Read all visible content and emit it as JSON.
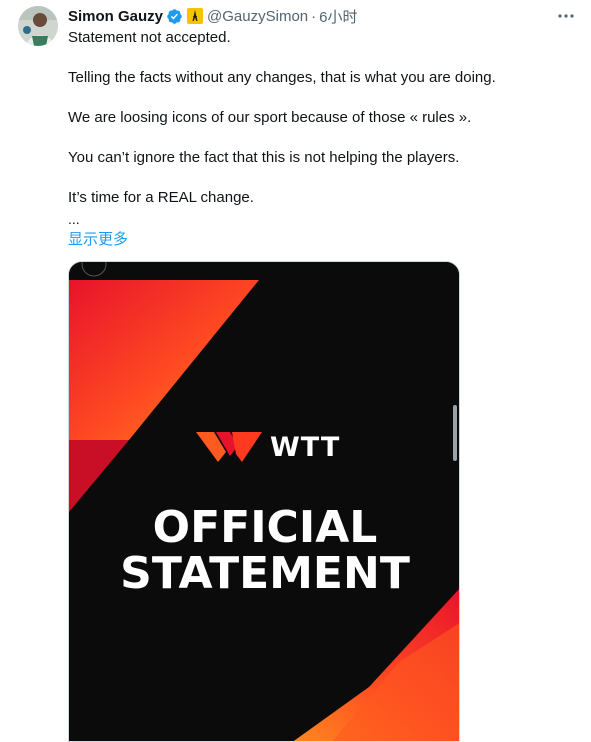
{
  "author": {
    "name": "Simon Gauzy",
    "handle": "@GauzySimon",
    "separator": "·",
    "time": "6小时"
  },
  "tweet": {
    "lines": [
      "Statement not accepted.",
      "Telling the facts without any changes, that is what you are doing.",
      "We are loosing icons of our sport because of those « rules ».",
      "You can’t ignore the fact that this is not helping the players.",
      "It’s time for a REAL change."
    ],
    "ellipsis": "...",
    "show_more": "显示更多"
  },
  "media": {
    "logo_text": "WTT",
    "headline_line1": "OFFICIAL",
    "headline_line2": "STATEMENT"
  },
  "colors": {
    "accent": "#1d9bf0",
    "verified": "#1d9bf0",
    "wtt_orange": "#ff5a1f",
    "wtt_red": "#e8132b",
    "media_bg": "#0b0b0b"
  },
  "icons": {
    "verified": "verified-badge-icon",
    "flag": "eiffel-tower-flag-icon",
    "more": "more-options-icon",
    "logo": "wtt-logo-icon"
  }
}
